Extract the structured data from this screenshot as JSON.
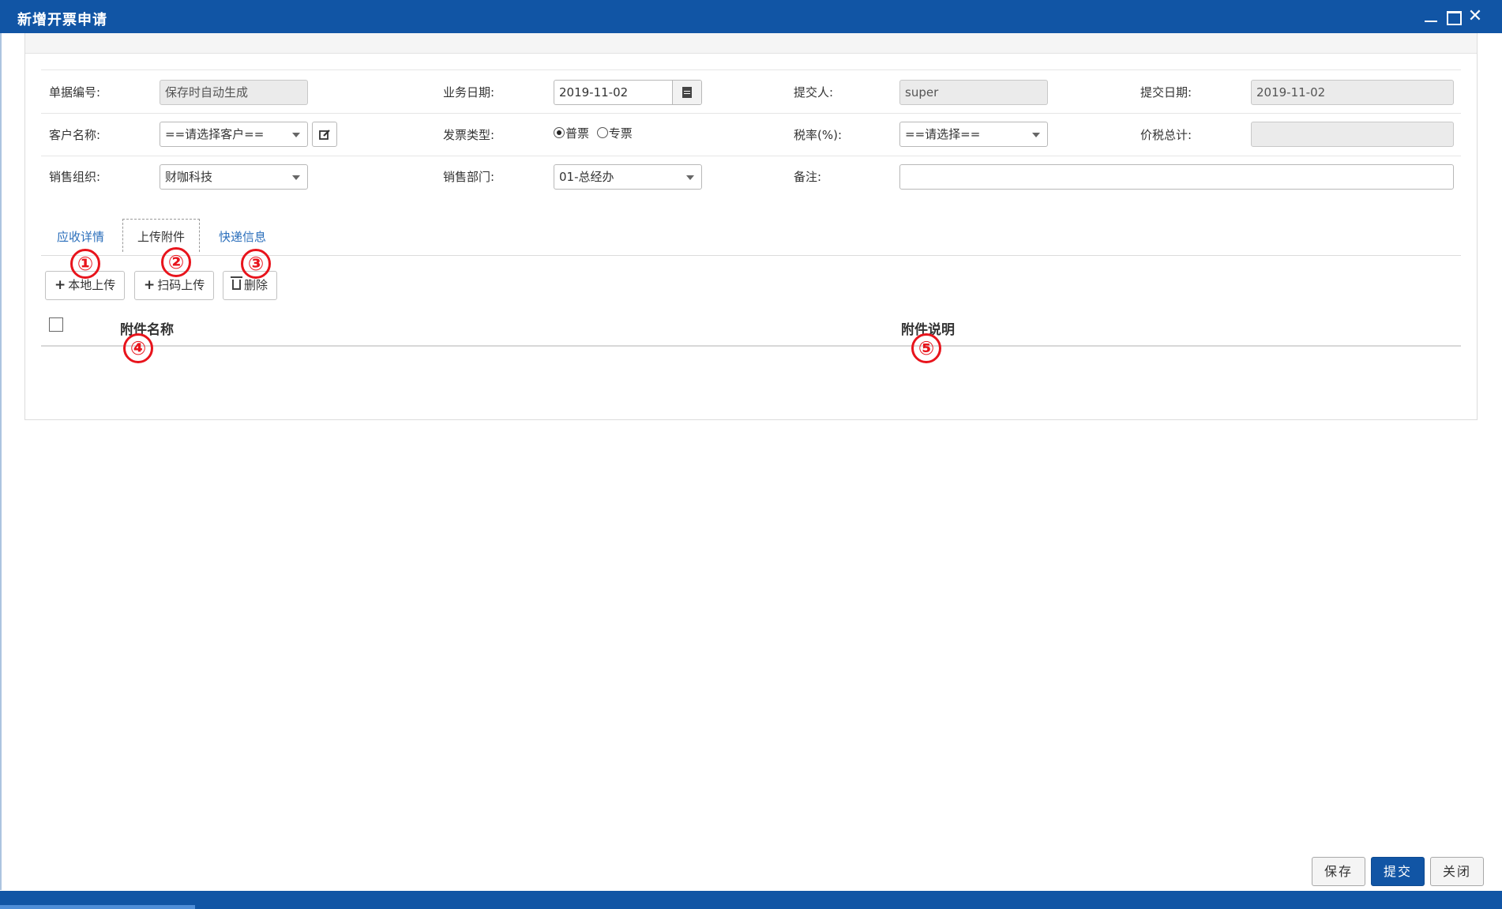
{
  "window": {
    "title": "新增开票申请"
  },
  "form": {
    "doc_no": {
      "label": "单据编号:",
      "value": "保存时自动生成"
    },
    "biz_date": {
      "label": "业务日期:",
      "value": "2019-11-02"
    },
    "submitter": {
      "label": "提交人:",
      "value": "super"
    },
    "submit_date": {
      "label": "提交日期:",
      "value": "2019-11-02"
    },
    "customer": {
      "label": "客户名称:",
      "value": "==请选择客户=="
    },
    "invoice_type": {
      "label": "发票类型:",
      "options": [
        "普票",
        "专票"
      ],
      "selected": "普票"
    },
    "tax_rate": {
      "label": "税率(%):",
      "value": "==请选择=="
    },
    "total": {
      "label": "价税总计:",
      "value": ""
    },
    "sales_org": {
      "label": "销售组织:",
      "value": "财咖科技"
    },
    "sales_dept": {
      "label": "销售部门:",
      "value": "01-总经办"
    },
    "remark": {
      "label": "备注:",
      "value": ""
    }
  },
  "tabs": [
    {
      "label": "应收详情"
    },
    {
      "label": "上传附件",
      "active": true
    },
    {
      "label": "快递信息"
    }
  ],
  "toolbar": {
    "local_upload": "本地上传",
    "scan_upload": "扫码上传",
    "delete": "删除"
  },
  "table": {
    "columns": [
      "附件名称",
      "附件说明"
    ]
  },
  "annotations": [
    "①",
    "②",
    "③",
    "④",
    "⑤"
  ],
  "footer": {
    "save": "保存",
    "submit": "提交",
    "close": "关闭"
  },
  "colors": {
    "title_bar": "#1155a5",
    "tab_link": "#2a6ebb",
    "annotation": "#e8141c"
  }
}
